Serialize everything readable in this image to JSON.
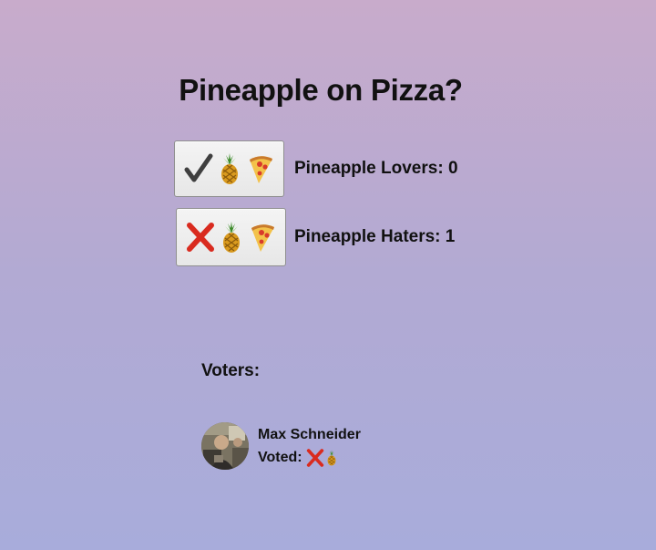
{
  "page": {
    "title": "Pineapple on Pizza?"
  },
  "votes": [
    {
      "label": "Pineapple Lovers",
      "count": "0",
      "button_icons": [
        "check-mark-icon",
        "pineapple-icon",
        "pizza-slice-icon"
      ]
    },
    {
      "label": "Pineapple Haters",
      "count": "1",
      "button_icons": [
        "cross-mark-icon",
        "pineapple-icon",
        "pizza-slice-icon"
      ]
    }
  ],
  "voters": {
    "heading": "Voters:",
    "list": [
      {
        "name": "Max Schneider",
        "voted_prefix": "Voted:",
        "voted_icons": [
          "cross-mark-icon",
          "pineapple-icon"
        ]
      }
    ]
  },
  "colors": {
    "background_top": "#c8abcb",
    "background_bottom": "#a8acdb",
    "check_mark": "#3f3f3f",
    "cross_mark": "#d92b1f",
    "button_face": "#efefef"
  }
}
